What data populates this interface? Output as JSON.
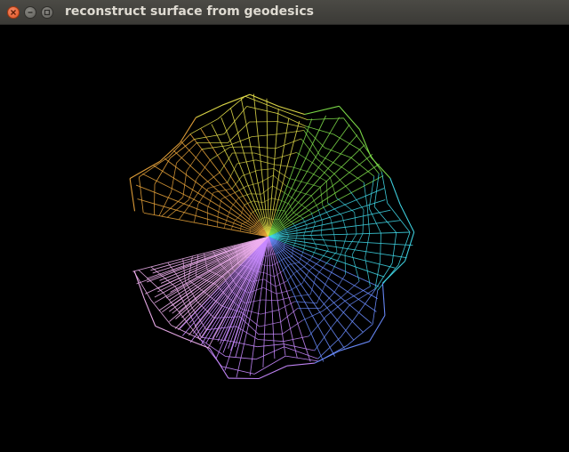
{
  "window": {
    "title": "reconstruct surface from geodesics",
    "controls": {
      "close_icon": "close-icon",
      "minimize_icon": "minimize-icon",
      "maximize_icon": "maximize-icon"
    }
  },
  "viewport": {
    "background": "#000000",
    "content": "wireframe-surface",
    "colors": {
      "orange": "#e8a33a",
      "yellow": "#e6e04a",
      "green": "#7fe04a",
      "cyan": "#40d8e8",
      "blue": "#6a8cff",
      "violet": "#c889ff",
      "pink": "#f0b0f0"
    }
  }
}
